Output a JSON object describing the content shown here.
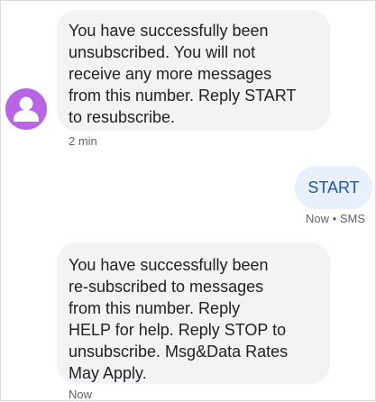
{
  "messages": [
    {
      "direction": "incoming",
      "text": "You have successfully been\nunsubscribed. You will not\nreceive any more messages\nfrom this number. Reply START\nto resubscribe.",
      "timestamp": "2 min"
    },
    {
      "direction": "outgoing",
      "text": "START",
      "status": "Now • SMS"
    },
    {
      "direction": "incoming",
      "text": "You have successfully been\nre-subscribed to messages\nfrom this number. Reply\nHELP for help. Reply STOP to\nunsubscribe. Msg&Data Rates\nMay Apply.",
      "timestamp": "Now"
    }
  ],
  "contact": {
    "avatar_icon": "person-icon",
    "avatar_color": "#b964e6"
  },
  "colors": {
    "incoming_bubble": "#f1f3f4",
    "outgoing_bubble": "#e8f0fe",
    "outgoing_text": "#1a56b8",
    "meta_text": "#5f6368"
  }
}
